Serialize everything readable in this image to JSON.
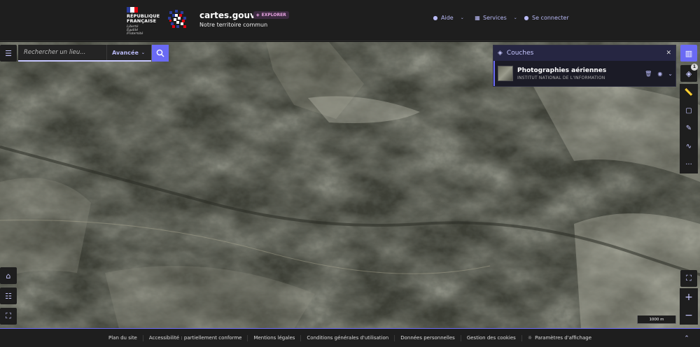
{
  "header": {
    "republic_line1": "RÉPUBLIQUE",
    "republic_line2": "FRANÇAISE",
    "motto1": "Liberté",
    "motto2": "Égalité",
    "motto3": "Fraternité",
    "site_title": "cartes.gouv.fr",
    "badge": "EXPLORER",
    "tagline": "Notre territoire commun",
    "nav": {
      "help": "Aide",
      "services": "Services",
      "login": "Se connecter"
    }
  },
  "search": {
    "placeholder": "Rechercher un lieu...",
    "advanced": "Avancée"
  },
  "layers_panel": {
    "title": "Couches",
    "count": "1",
    "layers": [
      {
        "name": "Photographies aériennes",
        "source": "INSTITUT NATIONAL DE L'INFORMATION"
      }
    ]
  },
  "map": {
    "scale_label": "1000 m"
  },
  "footer": {
    "links": [
      "Plan du site",
      "Accessibilité : partiellement conforme",
      "Mentions légales",
      "Conditions générales d'utilisation",
      "Données personnelles",
      "Gestion des cookies"
    ],
    "display_settings": "Paramètres d'affichage"
  },
  "colors": {
    "accent": "#6a6af4",
    "accent_light": "#c7c8ff",
    "header_bg": "#1e1e1e",
    "badge_text": "#e6a3e0"
  },
  "icons": {
    "menu": "hamburger-icon",
    "search": "search-icon",
    "map": "map-icon",
    "layers": "layers-icon",
    "ruler": "ruler-icon",
    "print": "print-icon",
    "draw": "pencil-icon",
    "route": "route-icon",
    "more": "more-icon",
    "fullscreen": "fullscreen-icon",
    "zoom_in": "plus-icon",
    "zoom_out": "minus-icon"
  }
}
